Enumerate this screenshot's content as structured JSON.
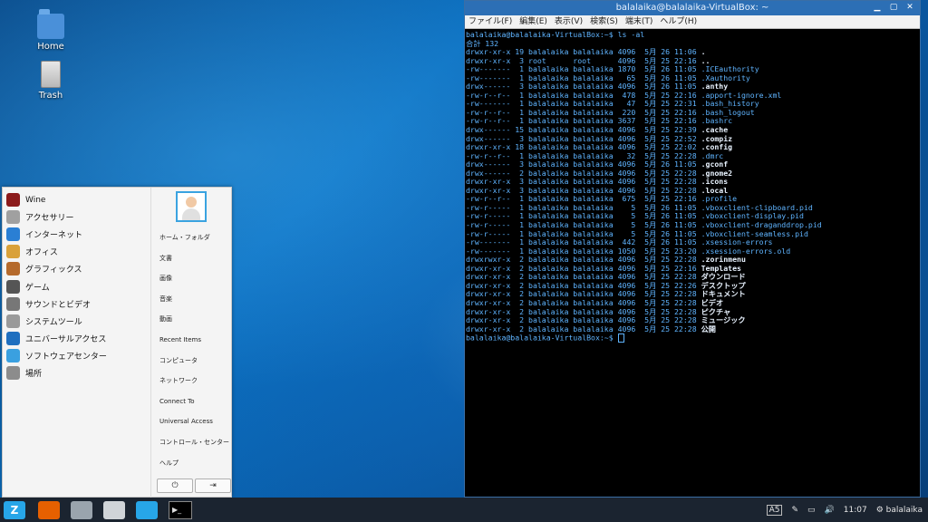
{
  "desktop": {
    "icons": [
      {
        "label": "Home",
        "icon": "folder-home-icon"
      },
      {
        "label": "Trash",
        "icon": "trash-icon"
      }
    ]
  },
  "terminal": {
    "title": "balalaika@balalaika-VirtualBox: ~",
    "menu": [
      "ファイル(F)",
      "編集(E)",
      "表示(V)",
      "検索(S)",
      "端末(T)",
      "ヘルプ(H)"
    ],
    "lines": [
      {
        "text": "balalaika@balalaika-VirtualBox:~$ ls -al",
        "dir": ""
      },
      {
        "text": "合計 132",
        "dir": ""
      },
      {
        "text": "drwxr-xr-x 19 balalaika balalaika 4096  5月 26 11:06 ",
        "dir": "."
      },
      {
        "text": "drwxr-xr-x  3 root      root      4096  5月 25 22:16 ",
        "dir": ".."
      },
      {
        "text": "-rw-------  1 balalaika balalaika 1870  5月 26 11:05 .ICEauthority",
        "dir": ""
      },
      {
        "text": "-rw-------  1 balalaika balalaika   65  5月 26 11:05 .Xauthority",
        "dir": ""
      },
      {
        "text": "drwx------  3 balalaika balalaika 4096  5月 26 11:05 ",
        "dir": ".anthy"
      },
      {
        "text": "-rw-r--r--  1 balalaika balalaika  478  5月 25 22:16 .apport-ignore.xml",
        "dir": ""
      },
      {
        "text": "-rw-------  1 balalaika balalaika   47  5月 25 22:31 .bash_history",
        "dir": ""
      },
      {
        "text": "-rw-r--r--  1 balalaika balalaika  220  5月 25 22:16 .bash_logout",
        "dir": ""
      },
      {
        "text": "-rw-r--r--  1 balalaika balalaika 3637  5月 25 22:16 .bashrc",
        "dir": ""
      },
      {
        "text": "drwx------ 15 balalaika balalaika 4096  5月 25 22:39 ",
        "dir": ".cache"
      },
      {
        "text": "drwx------  3 balalaika balalaika 4096  5月 25 22:52 ",
        "dir": ".compiz"
      },
      {
        "text": "drwxr-xr-x 18 balalaika balalaika 4096  5月 25 22:02 ",
        "dir": ".config"
      },
      {
        "text": "-rw-r--r--  1 balalaika balalaika   32  5月 25 22:28 .dmrc",
        "dir": ""
      },
      {
        "text": "drwx------  3 balalaika balalaika 4096  5月 26 11:05 ",
        "dir": ".gconf"
      },
      {
        "text": "drwx------  2 balalaika balalaika 4096  5月 25 22:28 ",
        "dir": ".gnome2"
      },
      {
        "text": "drwxr-xr-x  3 balalaika balalaika 4096  5月 25 22:28 ",
        "dir": ".icons"
      },
      {
        "text": "drwxr-xr-x  3 balalaika balalaika 4096  5月 25 22:28 ",
        "dir": ".local"
      },
      {
        "text": "-rw-r--r--  1 balalaika balalaika  675  5月 25 22:16 .profile",
        "dir": ""
      },
      {
        "text": "-rw-r-----  1 balalaika balalaika    5  5月 26 11:05 .vboxclient-clipboard.pid",
        "dir": ""
      },
      {
        "text": "-rw-r-----  1 balalaika balalaika    5  5月 26 11:05 .vboxclient-display.pid",
        "dir": ""
      },
      {
        "text": "-rw-r-----  1 balalaika balalaika    5  5月 26 11:05 .vboxclient-draganddrop.pid",
        "dir": ""
      },
      {
        "text": "-rw-r-----  1 balalaika balalaika    5  5月 26 11:05 .vboxclient-seamless.pid",
        "dir": ""
      },
      {
        "text": "-rw-------  1 balalaika balalaika  442  5月 26 11:05 .xsession-errors",
        "dir": ""
      },
      {
        "text": "-rw-------  1 balalaika balalaika 1050  5月 25 23:20 .xsession-errors.old",
        "dir": ""
      },
      {
        "text": "drwxrwxr-x  2 balalaika balalaika 4096  5月 25 22:28 ",
        "dir": ".zorinmenu"
      },
      {
        "text": "drwxr-xr-x  2 balalaika balalaika 4096  5月 25 22:16 ",
        "dir": "Templates"
      },
      {
        "text": "drwxr-xr-x  2 balalaika balalaika 4096  5月 25 22:28 ",
        "dir": "ダウンロード"
      },
      {
        "text": "drwxr-xr-x  2 balalaika balalaika 4096  5月 25 22:26 ",
        "dir": "デスクトップ"
      },
      {
        "text": "drwxr-xr-x  2 balalaika balalaika 4096  5月 25 22:28 ",
        "dir": "ドキュメント"
      },
      {
        "text": "drwxr-xr-x  2 balalaika balalaika 4096  5月 25 22:28 ",
        "dir": "ビデオ"
      },
      {
        "text": "drwxr-xr-x  2 balalaika balalaika 4096  5月 25 22:28 ",
        "dir": "ピクチャ"
      },
      {
        "text": "drwxr-xr-x  2 balalaika balalaika 4096  5月 25 22:28 ",
        "dir": "ミュージック"
      },
      {
        "text": "drwxr-xr-x  2 balalaika balalaika 4096  5月 25 22:28 ",
        "dir": "公開"
      }
    ],
    "prompt": "balalaika@balalaika-VirtualBox:~$ "
  },
  "startmenu": {
    "categories": [
      {
        "label": "Wine",
        "icon": "wine-icon",
        "color": "#8b1a1a"
      },
      {
        "label": "アクセサリー",
        "icon": "accessories-icon",
        "color": "#a0a0a0"
      },
      {
        "label": "インターネット",
        "icon": "internet-icon",
        "color": "#2a7fd4"
      },
      {
        "label": "オフィス",
        "icon": "office-icon",
        "color": "#d9a13a"
      },
      {
        "label": "グラフィックス",
        "icon": "graphics-icon",
        "color": "#b56a2c"
      },
      {
        "label": "ゲーム",
        "icon": "games-icon",
        "color": "#555555"
      },
      {
        "label": "サウンドとビデオ",
        "icon": "sound-video-icon",
        "color": "#777777"
      },
      {
        "label": "システムツール",
        "icon": "system-tools-icon",
        "color": "#9a9a9a"
      },
      {
        "label": "ユニバーサルアクセス",
        "icon": "universal-access-icon",
        "color": "#1f6fbf"
      },
      {
        "label": "ソフトウェアセンター",
        "icon": "software-center-icon",
        "color": "#3aa0e0"
      },
      {
        "label": "場所",
        "icon": "places-icon",
        "color": "#8c8c8c"
      }
    ],
    "places": [
      "ホーム・フォルダ",
      "文書",
      "画像",
      "音楽",
      "動画",
      "Recent Items",
      "コンピュータ",
      "ネットワーク",
      "Connect To",
      "Universal Access",
      "コントロール・センター",
      "ヘルプ"
    ],
    "power_glyph": "⏻",
    "logout_glyph": "⇥"
  },
  "taskbar": {
    "start_glyph": "Z",
    "apps": [
      {
        "name": "firefox-icon",
        "color": "#e66000"
      },
      {
        "name": "file-manager-icon",
        "color": "#9aa4ad"
      },
      {
        "name": "system-icon",
        "color": "#d0d4d8"
      },
      {
        "name": "zorin-appearance-icon",
        "color": "#27a6e8"
      }
    ],
    "terminal_glyph": "▶_",
    "tray": {
      "keyboard_badge": "A5",
      "volume_glyph": "🔊",
      "battery_glyph": "▭",
      "time": "11:07",
      "user_glyph": "⚙",
      "user": "balalaika"
    }
  }
}
